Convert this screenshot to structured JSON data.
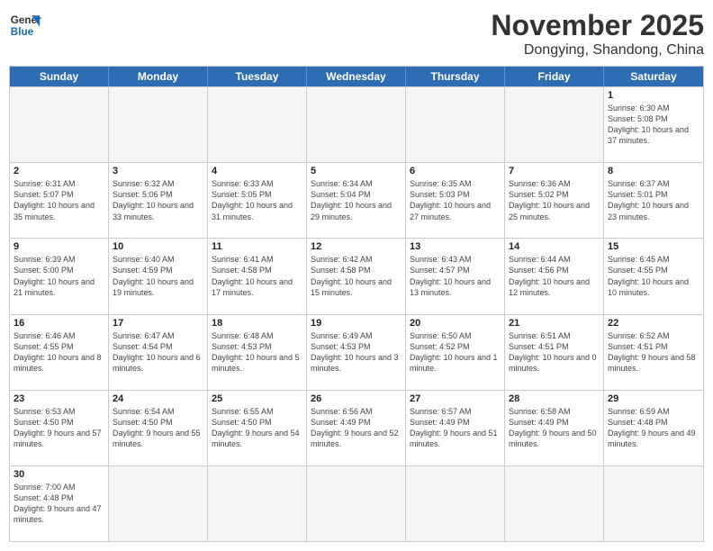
{
  "logo": {
    "line1": "General",
    "line2": "Blue"
  },
  "header": {
    "month": "November 2025",
    "location": "Dongying, Shandong, China"
  },
  "weekdays": [
    "Sunday",
    "Monday",
    "Tuesday",
    "Wednesday",
    "Thursday",
    "Friday",
    "Saturday"
  ],
  "weeks": [
    [
      {
        "date": "",
        "info": "",
        "empty": true
      },
      {
        "date": "",
        "info": "",
        "empty": true
      },
      {
        "date": "",
        "info": "",
        "empty": true
      },
      {
        "date": "",
        "info": "",
        "empty": true
      },
      {
        "date": "",
        "info": "",
        "empty": true
      },
      {
        "date": "",
        "info": "",
        "empty": true
      },
      {
        "date": "1",
        "info": "Sunrise: 6:30 AM\nSunset: 5:08 PM\nDaylight: 10 hours and 37 minutes."
      }
    ],
    [
      {
        "date": "2",
        "info": "Sunrise: 6:31 AM\nSunset: 5:07 PM\nDaylight: 10 hours and 35 minutes."
      },
      {
        "date": "3",
        "info": "Sunrise: 6:32 AM\nSunset: 5:06 PM\nDaylight: 10 hours and 33 minutes."
      },
      {
        "date": "4",
        "info": "Sunrise: 6:33 AM\nSunset: 5:05 PM\nDaylight: 10 hours and 31 minutes."
      },
      {
        "date": "5",
        "info": "Sunrise: 6:34 AM\nSunset: 5:04 PM\nDaylight: 10 hours and 29 minutes."
      },
      {
        "date": "6",
        "info": "Sunrise: 6:35 AM\nSunset: 5:03 PM\nDaylight: 10 hours and 27 minutes."
      },
      {
        "date": "7",
        "info": "Sunrise: 6:36 AM\nSunset: 5:02 PM\nDaylight: 10 hours and 25 minutes."
      },
      {
        "date": "8",
        "info": "Sunrise: 6:37 AM\nSunset: 5:01 PM\nDaylight: 10 hours and 23 minutes."
      }
    ],
    [
      {
        "date": "9",
        "info": "Sunrise: 6:39 AM\nSunset: 5:00 PM\nDaylight: 10 hours and 21 minutes."
      },
      {
        "date": "10",
        "info": "Sunrise: 6:40 AM\nSunset: 4:59 PM\nDaylight: 10 hours and 19 minutes."
      },
      {
        "date": "11",
        "info": "Sunrise: 6:41 AM\nSunset: 4:58 PM\nDaylight: 10 hours and 17 minutes."
      },
      {
        "date": "12",
        "info": "Sunrise: 6:42 AM\nSunset: 4:58 PM\nDaylight: 10 hours and 15 minutes."
      },
      {
        "date": "13",
        "info": "Sunrise: 6:43 AM\nSunset: 4:57 PM\nDaylight: 10 hours and 13 minutes."
      },
      {
        "date": "14",
        "info": "Sunrise: 6:44 AM\nSunset: 4:56 PM\nDaylight: 10 hours and 12 minutes."
      },
      {
        "date": "15",
        "info": "Sunrise: 6:45 AM\nSunset: 4:55 PM\nDaylight: 10 hours and 10 minutes."
      }
    ],
    [
      {
        "date": "16",
        "info": "Sunrise: 6:46 AM\nSunset: 4:55 PM\nDaylight: 10 hours and 8 minutes."
      },
      {
        "date": "17",
        "info": "Sunrise: 6:47 AM\nSunset: 4:54 PM\nDaylight: 10 hours and 6 minutes."
      },
      {
        "date": "18",
        "info": "Sunrise: 6:48 AM\nSunset: 4:53 PM\nDaylight: 10 hours and 5 minutes."
      },
      {
        "date": "19",
        "info": "Sunrise: 6:49 AM\nSunset: 4:53 PM\nDaylight: 10 hours and 3 minutes."
      },
      {
        "date": "20",
        "info": "Sunrise: 6:50 AM\nSunset: 4:52 PM\nDaylight: 10 hours and 1 minute."
      },
      {
        "date": "21",
        "info": "Sunrise: 6:51 AM\nSunset: 4:51 PM\nDaylight: 10 hours and 0 minutes."
      },
      {
        "date": "22",
        "info": "Sunrise: 6:52 AM\nSunset: 4:51 PM\nDaylight: 9 hours and 58 minutes."
      }
    ],
    [
      {
        "date": "23",
        "info": "Sunrise: 6:53 AM\nSunset: 4:50 PM\nDaylight: 9 hours and 57 minutes."
      },
      {
        "date": "24",
        "info": "Sunrise: 6:54 AM\nSunset: 4:50 PM\nDaylight: 9 hours and 55 minutes."
      },
      {
        "date": "25",
        "info": "Sunrise: 6:55 AM\nSunset: 4:50 PM\nDaylight: 9 hours and 54 minutes."
      },
      {
        "date": "26",
        "info": "Sunrise: 6:56 AM\nSunset: 4:49 PM\nDaylight: 9 hours and 52 minutes."
      },
      {
        "date": "27",
        "info": "Sunrise: 6:57 AM\nSunset: 4:49 PM\nDaylight: 9 hours and 51 minutes."
      },
      {
        "date": "28",
        "info": "Sunrise: 6:58 AM\nSunset: 4:49 PM\nDaylight: 9 hours and 50 minutes."
      },
      {
        "date": "29",
        "info": "Sunrise: 6:59 AM\nSunset: 4:48 PM\nDaylight: 9 hours and 49 minutes."
      }
    ],
    [
      {
        "date": "30",
        "info": "Sunrise: 7:00 AM\nSunset: 4:48 PM\nDaylight: 9 hours and 47 minutes."
      },
      {
        "date": "",
        "info": "",
        "empty": true
      },
      {
        "date": "",
        "info": "",
        "empty": true
      },
      {
        "date": "",
        "info": "",
        "empty": true
      },
      {
        "date": "",
        "info": "",
        "empty": true
      },
      {
        "date": "",
        "info": "",
        "empty": true
      },
      {
        "date": "",
        "info": "",
        "empty": true
      }
    ]
  ]
}
